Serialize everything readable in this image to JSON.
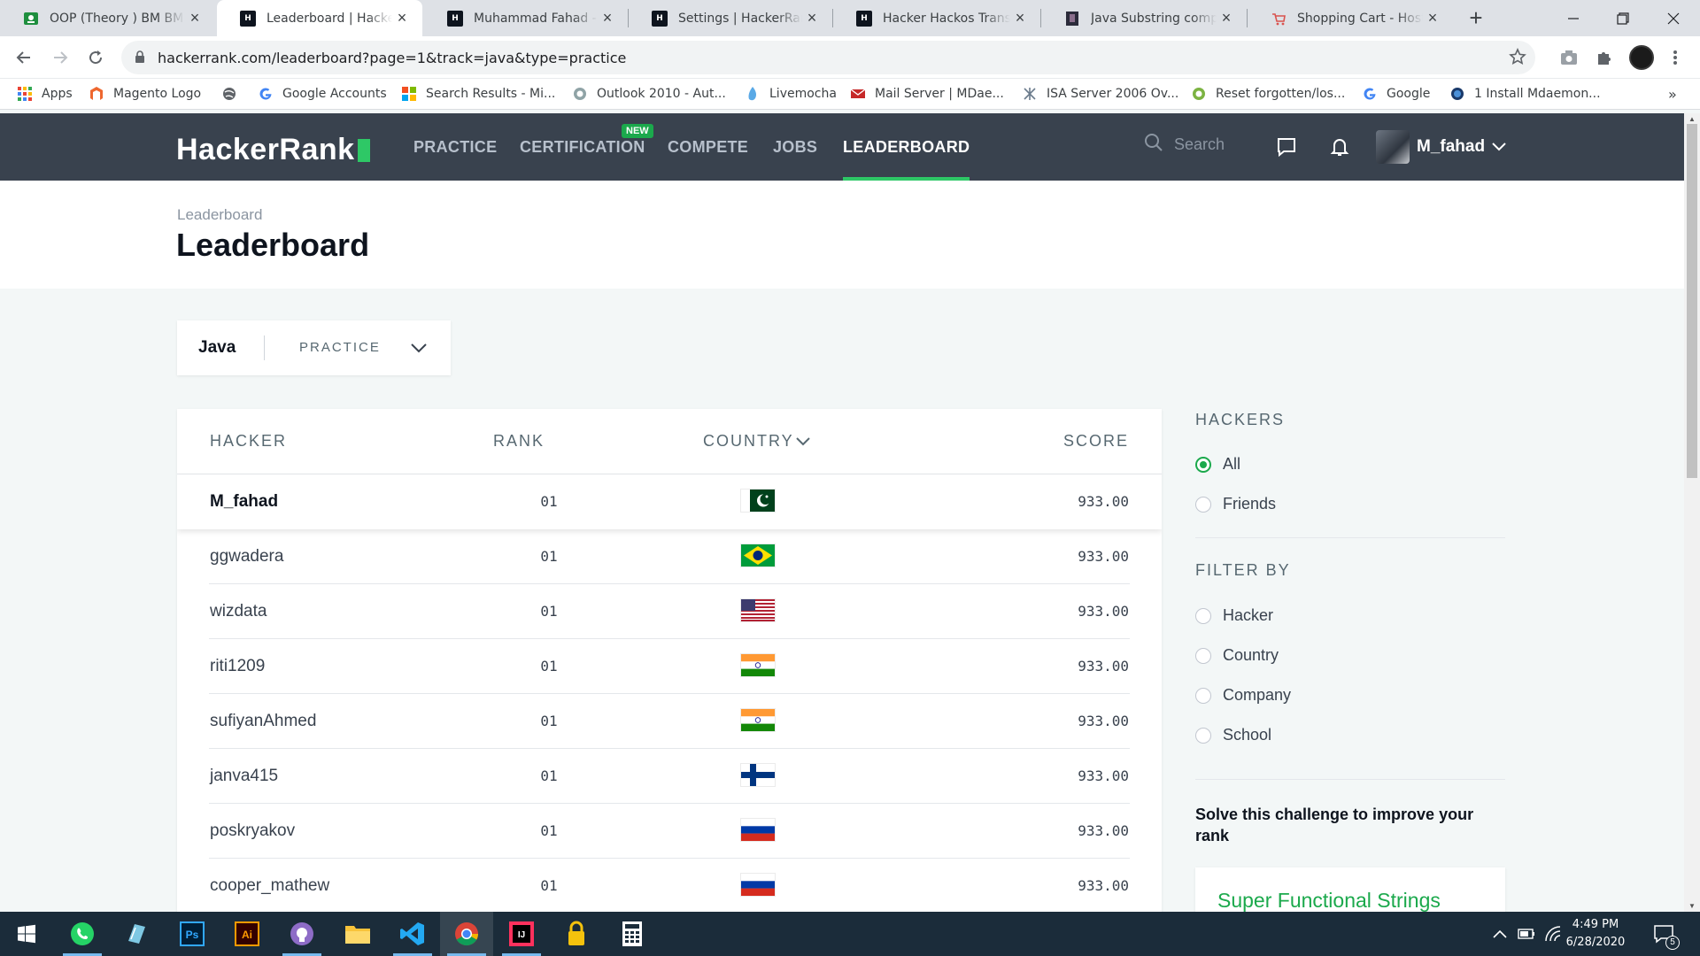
{
  "browser": {
    "tabs": [
      {
        "title": "OOP (Theory ) BM BM",
        "icon": "classroom-icon"
      },
      {
        "title": "Leaderboard | HackerRank",
        "icon": "hackerrank-icon",
        "active": true
      },
      {
        "title": "Muhammad Fahad - FAST",
        "icon": "hackerrank-icon"
      },
      {
        "title": "Settings | HackerRank",
        "icon": "hackerrank-icon"
      },
      {
        "title": "Hacker Hackos Transactions",
        "icon": "hackerrank-icon"
      },
      {
        "title": "Java Substring comparisons",
        "icon": "video-icon"
      },
      {
        "title": "Shopping Cart - Hosted",
        "icon": "cart-icon"
      }
    ],
    "new_tab": "+",
    "url": "hackerrank.com/leaderboard?page=1&track=java&type=practice",
    "bookmarks": [
      {
        "label": "Apps",
        "icon": "apps-grid-icon"
      },
      {
        "label": "Magento Logo",
        "icon": "magento-icon"
      },
      {
        "label": "",
        "icon": "globe-icon"
      },
      {
        "label": "Google Accounts",
        "icon": "google-icon"
      },
      {
        "label": "Search Results - Mi...",
        "icon": "microsoft-icon"
      },
      {
        "label": "Outlook 2010 - Aut...",
        "icon": "outlook-icon"
      },
      {
        "label": "Livemocha",
        "icon": "livemocha-icon"
      },
      {
        "label": "Mail Server | MDae...",
        "icon": "mail-icon"
      },
      {
        "label": "ISA Server 2006 Ov...",
        "icon": "isa-icon"
      },
      {
        "label": "Reset forgotten/los...",
        "icon": "reset-icon"
      },
      {
        "label": "Google",
        "icon": "google-icon"
      },
      {
        "label": "1 Install Mdaemon...",
        "icon": "install-icon"
      }
    ],
    "more_bookmarks": "»"
  },
  "hr": {
    "logo": "HackerRank",
    "nav": [
      {
        "label": "PRACTICE"
      },
      {
        "label": "CERTIFICATION",
        "badge": "NEW"
      },
      {
        "label": "COMPETE"
      },
      {
        "label": "JOBS"
      },
      {
        "label": "LEADERBOARD",
        "active": true
      }
    ],
    "search_placeholder": "Search",
    "username": "M_fahad",
    "accent": "#2ec866",
    "nav_bg": "#39424e"
  },
  "page": {
    "breadcrumb": "Leaderboard",
    "title": "Leaderboard"
  },
  "track": {
    "name": "Java",
    "type": "PRACTICE"
  },
  "table": {
    "headers": {
      "hacker": "HACKER",
      "rank": "RANK",
      "country": "COUNTRY",
      "score": "SCORE"
    },
    "rows": [
      {
        "hacker": "M_fahad",
        "rank": "01",
        "country_flag": "pakistan",
        "score": "933.00",
        "current_user": true
      },
      {
        "hacker": "ggwadera",
        "rank": "01",
        "country_flag": "brazil",
        "score": "933.00"
      },
      {
        "hacker": "wizdata",
        "rank": "01",
        "country_flag": "usa",
        "score": "933.00"
      },
      {
        "hacker": "riti1209",
        "rank": "01",
        "country_flag": "india",
        "score": "933.00"
      },
      {
        "hacker": "sufiyanAhmed",
        "rank": "01",
        "country_flag": "india",
        "score": "933.00"
      },
      {
        "hacker": "janva415",
        "rank": "01",
        "country_flag": "finland",
        "score": "933.00"
      },
      {
        "hacker": "poskryakov",
        "rank": "01",
        "country_flag": "russia",
        "score": "933.00"
      },
      {
        "hacker": "cooper_mathew",
        "rank": "01",
        "country_flag": "russia",
        "score": "933.00"
      }
    ]
  },
  "sidebar": {
    "hackers_heading": "HACKERS",
    "hackers_options": [
      {
        "label": "All",
        "selected": true
      },
      {
        "label": "Friends",
        "selected": false
      }
    ],
    "filter_heading": "FILTER BY",
    "filter_options": [
      {
        "label": "Hacker"
      },
      {
        "label": "Country"
      },
      {
        "label": "Company"
      },
      {
        "label": "School"
      }
    ],
    "solve_text": "Solve this challenge to improve your rank",
    "challenge": "Super Functional Strings"
  },
  "taskbar": {
    "apps": [
      "windows-start-icon",
      "whatsapp-icon",
      "notepad-icon",
      "photoshop-icon",
      "illustrator-icon",
      "github-icon",
      "file-explorer-icon",
      "vscode-icon",
      "chrome-icon",
      "intellij-icon",
      "keepass-icon",
      "calculator-icon"
    ],
    "time": "4:49 PM",
    "date": "6/28/2020",
    "notifications": "5"
  }
}
